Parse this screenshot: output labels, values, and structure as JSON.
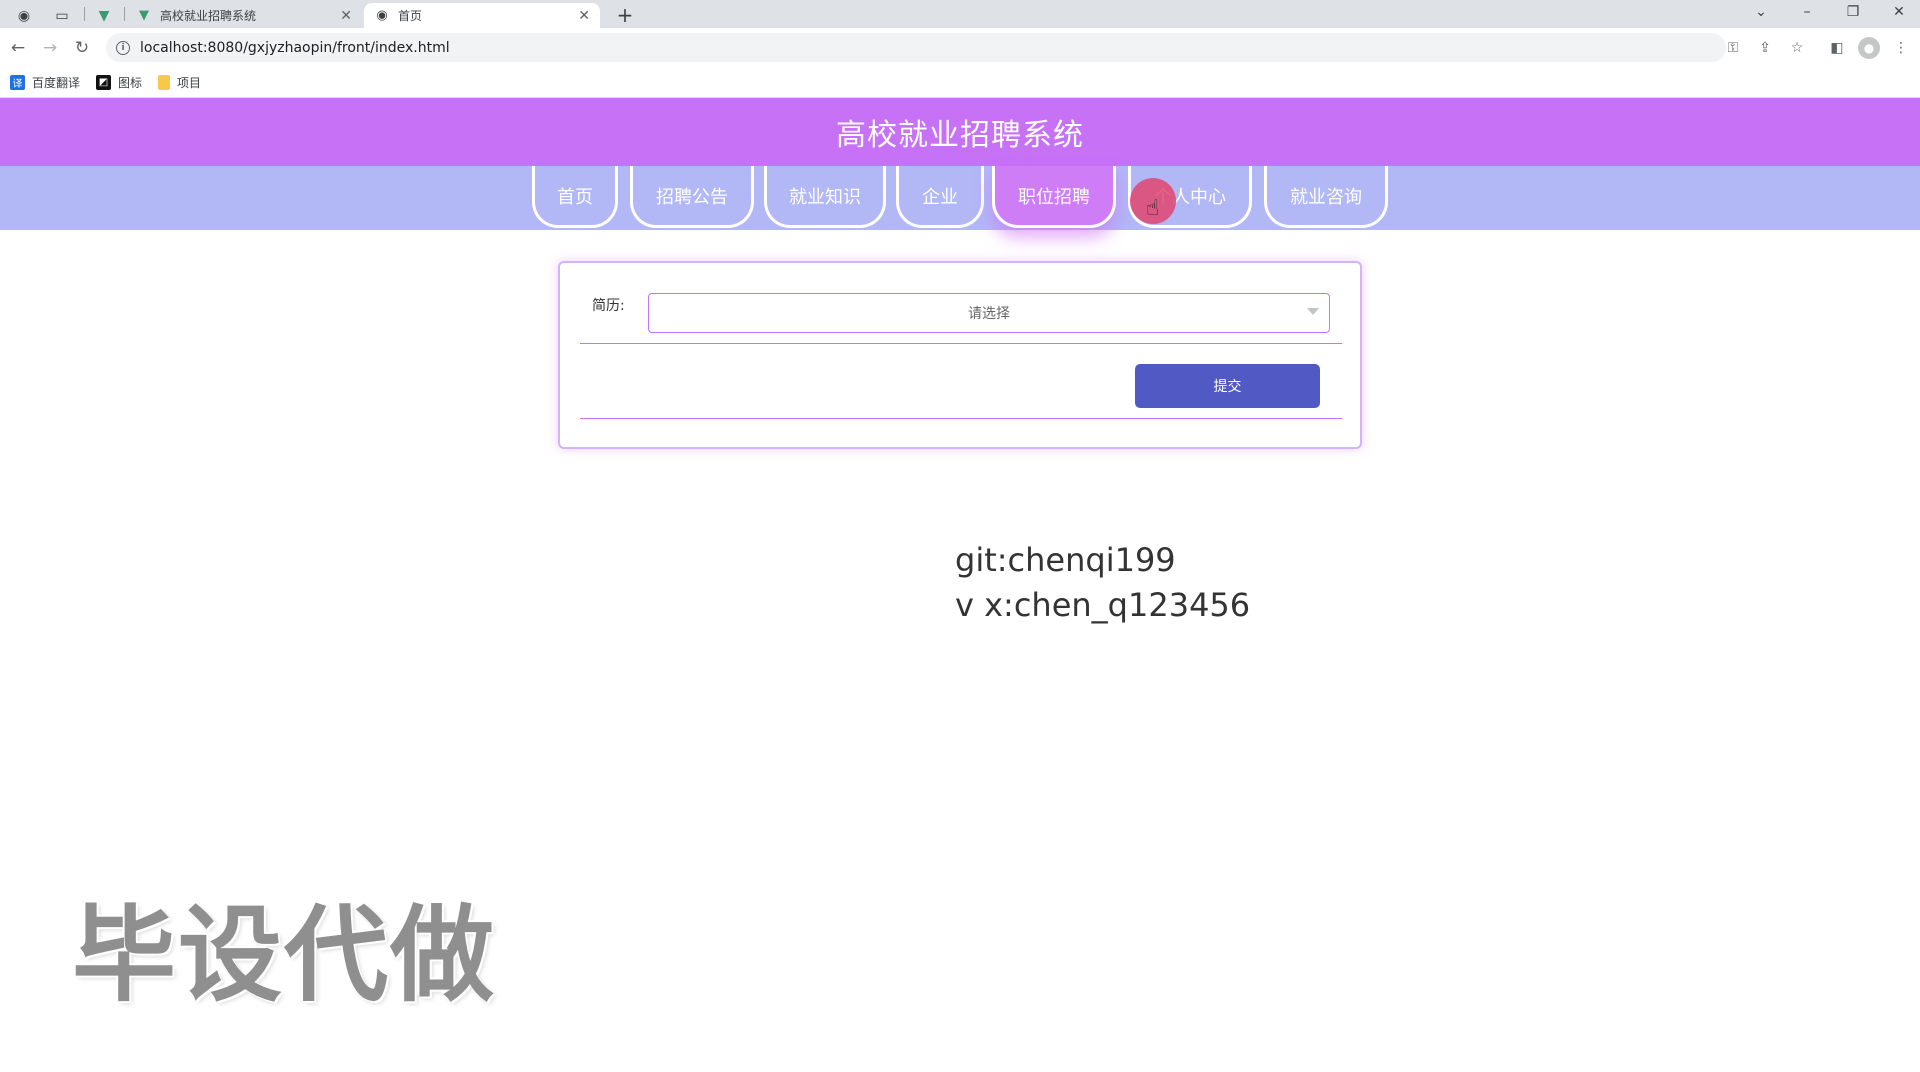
{
  "browser": {
    "tabs": [
      {
        "title": "高校就业招聘系统",
        "favicon": "vue-icon"
      },
      {
        "title": "首页",
        "favicon": "globe-icon",
        "active": true
      }
    ],
    "url": "localhost:8080/gxjyzhaopin/front/index.html",
    "bookmarks": [
      {
        "label": "百度翻译",
        "icon": "translate-icon",
        "color": "#1e6fe8"
      },
      {
        "label": "图标",
        "icon": "iconfont-icon",
        "color": "#111111"
      },
      {
        "label": "项目",
        "icon": "folder-icon",
        "color": "#f6c94a"
      }
    ]
  },
  "header": {
    "title": "高校就业招聘系统",
    "color": "#c771f7"
  },
  "nav": {
    "color": "#b2b7f6",
    "items": [
      {
        "label": "首页"
      },
      {
        "label": "招聘公告"
      },
      {
        "label": "就业知识"
      },
      {
        "label": "企业"
      },
      {
        "label": "职位招聘",
        "active": true
      },
      {
        "label": "个人中心"
      },
      {
        "label": "就业咨询"
      }
    ]
  },
  "form": {
    "resume_label": "简历:",
    "resume_placeholder": "请选择",
    "submit_label": "提交",
    "submit_color": "#5159c5"
  },
  "overlay": {
    "contact_line1": "git:chenqi199",
    "contact_line2": "v x:chen_q123456",
    "watermark": "毕设代做"
  }
}
